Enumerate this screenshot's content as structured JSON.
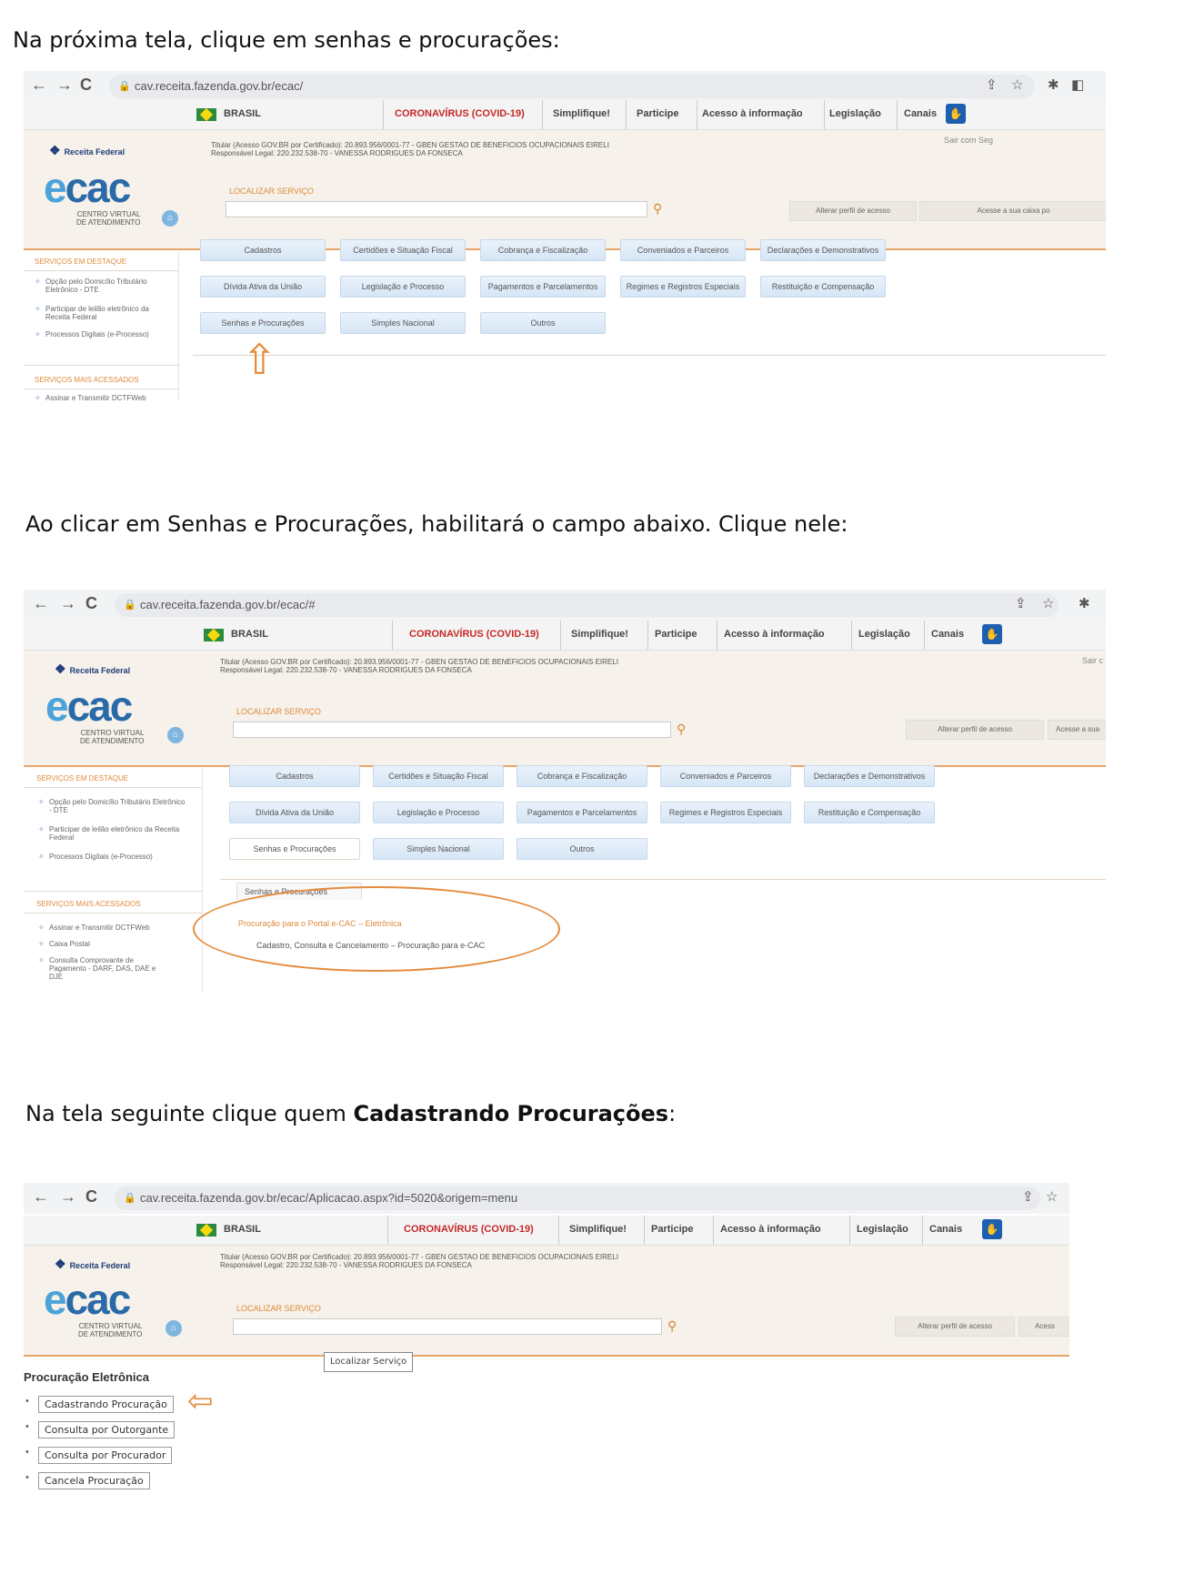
{
  "instructions": {
    "step1": "Na próxima tela, clique em senhas e procurações:",
    "step2": "Ao clicar em Senhas e Procurações, habilitará o campo abaixo. Clique nele:",
    "step3_a": "Na tela seguinte clique quem ",
    "step3_b": "Cadastrando Procurações",
    "step3_c": ":"
  },
  "browser": {
    "url1": "cav.receita.fazenda.gov.br/ecac/",
    "url2": "cav.receita.fazenda.gov.br/ecac/#",
    "url3": "cav.receita.fazenda.gov.br/ecac/Aplicacao.aspx?id=5020&origem=menu",
    "back": "←",
    "forward": "→",
    "reload": "C",
    "lock": "🔒",
    "share": "⇪",
    "star": "☆",
    "ext": "✱",
    "side": "◧"
  },
  "govbar": {
    "brasil": "BRASIL",
    "covid": "CORONAVÍRUS (COVID-19)",
    "simplifique": "Simplifique!",
    "participe": "Participe",
    "acesso": "Acesso à informação",
    "legislacao": "Legislação",
    "canais": "Canais",
    "access_glyph": "✋"
  },
  "header": {
    "receita": "Receita Federal",
    "logo_e": "e",
    "logo_rest": "cac",
    "sub1": "CENTRO VIRTUAL",
    "sub2": "DE ATENDIMENTO",
    "home": "⌂",
    "titular": "Titular (Acesso GOV.BR por Certificado): 20.893.956/0001-77 - GBEN GESTAO DE BENEFICIOS OCUPACIONAIS EIRELI",
    "responsavel": "Responsável Legal: 220.232.538-70 - VANESSA RODRIGUES DA FONSECA",
    "localizar": "LOCALIZAR SERVIÇO",
    "mag": "⚲",
    "alterar": "Alterar perfil de acesso",
    "acesse1": "Acesse a sua caixa po",
    "acesse2": "Acesse a sua",
    "acesse3": "Acess",
    "sair1": "Sair com Seg",
    "sair2": "Sair c"
  },
  "left": {
    "destaque": "SERVIÇOS EM DESTAQUE",
    "item1": "Opção pelo Domicílio Tributário Eletrônico - DTE",
    "item2": "Participar de leilão eletrônico da Receita Federal",
    "item3": "Processos Digitais (e-Processo)",
    "mais": "SERVIÇOS MAIS ACESSADOS",
    "mais1": "Assinar e Transmitir DCTFWeb",
    "mais2": "Caixa Postal",
    "mais3": "Consulta Comprovante de Pagamento - DARF, DAS, DAE e DJE"
  },
  "menu": {
    "cadastros": "Cadastros",
    "certidoes": "Certidões e Situação Fiscal",
    "cobranca": "Cobrança e Fiscalização",
    "conveniados": "Conveniados e Parceiros",
    "declaracoes": "Declarações e Demonstrativos",
    "divida": "Dívida Ativa da União",
    "legislacao": "Legislação e Processo",
    "pagamentos": "Pagamentos e Parcelamentos",
    "regimes": "Regimes e Registros Especiais",
    "restituicao": "Restituição e Compensação",
    "senhas": "Senhas e Procurações",
    "simples": "Simples Nacional",
    "outros": "Outros"
  },
  "submenu": {
    "tab": "Senhas e Procurações",
    "proc_portal": "Procuração para o Portal e-CAC – Eletrônica",
    "cadastro": "Cadastro, Consulta e Cancelamento – Procuração para e-CAC"
  },
  "proc": {
    "title": "Procuração Eletrônica",
    "tooltip": "Localizar Serviço",
    "links": [
      "Cadastrando Procuração",
      "Consulta por Outorgante",
      "Consulta por Procurador",
      "Cancela Procuração"
    ],
    "bullet": "•"
  },
  "arrows": {
    "up": "⇧",
    "left": "⇦"
  },
  "colors": {
    "accent": "#e48b3d",
    "covid": "#c62828",
    "brand": "#2b6aa8"
  }
}
